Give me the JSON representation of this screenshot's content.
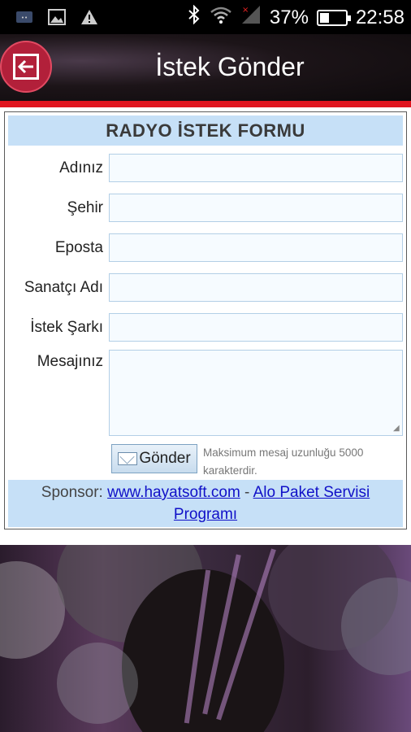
{
  "status_bar": {
    "battery_percent": "37%",
    "battery_level": 0.37,
    "time": "22:58",
    "icons": [
      "notification-icon",
      "image-icon",
      "warning-icon",
      "bluetooth-icon",
      "wifi-icon",
      "signal-icon"
    ]
  },
  "header": {
    "title": "İstek Gönder",
    "back_icon": "back-arrow-icon",
    "accent_color": "#b2203a"
  },
  "form": {
    "title": "RADYO İSTEK FORMU",
    "fields": [
      {
        "label": "Adınız",
        "value": "",
        "placeholder": ""
      },
      {
        "label": "Şehir",
        "value": "",
        "placeholder": ""
      },
      {
        "label": "Eposta",
        "value": "",
        "placeholder": ""
      },
      {
        "label": "Sanatçı Adı",
        "value": "",
        "placeholder": ""
      },
      {
        "label": "İstek Şarkı",
        "value": "",
        "placeholder": ""
      }
    ],
    "message": {
      "label": "Mesajınız",
      "value": "",
      "placeholder": ""
    },
    "send_label": "Gönder",
    "note": "Maksimum mesaj uzunluğu 5000 karakterdir."
  },
  "sponsor": {
    "prefix": "Sponsor:",
    "link1": "www.hayatsoft.com",
    "separator": "-",
    "link2": "Alo Paket Servisi Programı"
  }
}
